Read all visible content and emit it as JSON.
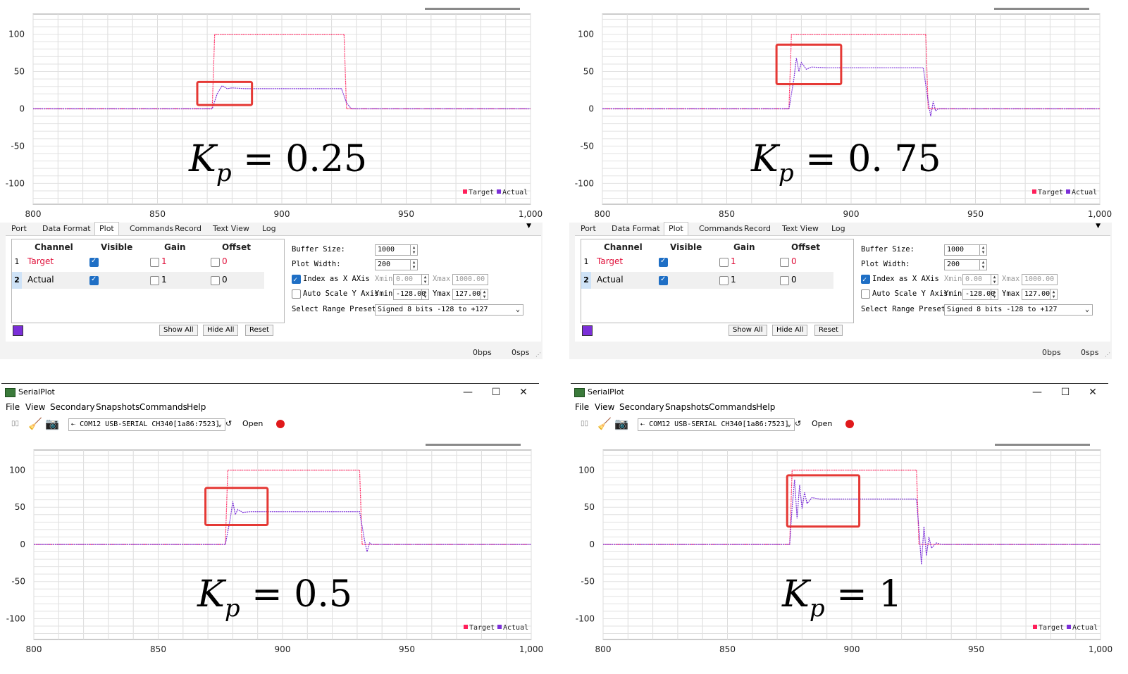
{
  "chart_data": [
    {
      "type": "line",
      "title": "",
      "xlabel": "",
      "ylabel": "",
      "x_ticks": [
        "800",
        "850",
        "900",
        "950",
        "1,000"
      ],
      "y_ticks": [
        "100",
        "50",
        "0",
        "-50",
        "-100"
      ],
      "xlim": [
        800,
        1000
      ],
      "ylim": [
        -128,
        127
      ],
      "grid": true,
      "legend": "bottom-right",
      "series": [
        {
          "name": "Target",
          "color": "#ff1f5a",
          "x": [
            800,
            872,
            873,
            925,
            926,
            1000
          ],
          "y": [
            0,
            0,
            100,
            100,
            0,
            0
          ]
        },
        {
          "name": "Actual",
          "color": "#7b2fd8",
          "x": [
            800,
            872,
            874,
            876,
            878,
            880,
            885,
            900,
            910,
            920,
            924,
            926,
            928,
            1000
          ],
          "y": [
            0,
            0,
            20,
            31,
            27,
            28,
            27,
            27,
            27,
            27,
            27,
            8,
            0,
            0
          ]
        }
      ]
    },
    {
      "type": "line",
      "title": "",
      "xlabel": "",
      "ylabel": "",
      "x_ticks": [
        "800",
        "850",
        "900",
        "950",
        "1,000"
      ],
      "y_ticks": [
        "100",
        "50",
        "0",
        "-50",
        "-100"
      ],
      "xlim": [
        800,
        1000
      ],
      "ylim": [
        -128,
        127
      ],
      "grid": true,
      "legend": "bottom-right",
      "series": [
        {
          "name": "Target",
          "color": "#ff1f5a",
          "x": [
            800,
            875,
            876,
            930,
            931,
            1000
          ],
          "y": [
            0,
            0,
            100,
            100,
            0,
            0
          ]
        },
        {
          "name": "Actual",
          "color": "#7b2fd8",
          "x": [
            800,
            875,
            877,
            878,
            879,
            880,
            882,
            884,
            890,
            900,
            910,
            920,
            929,
            931,
            932,
            933,
            934,
            935,
            1000
          ],
          "y": [
            0,
            0,
            40,
            68,
            50,
            62,
            53,
            56,
            55,
            55,
            55,
            55,
            55,
            10,
            -10,
            10,
            -3,
            0,
            0
          ]
        }
      ]
    },
    {
      "type": "line",
      "title": "",
      "xlabel": "",
      "ylabel": "",
      "x_ticks": [
        "800",
        "850",
        "900",
        "950",
        "1,000"
      ],
      "y_ticks": [
        "100",
        "50",
        "0",
        "-50",
        "-100"
      ],
      "xlim": [
        800,
        1000
      ],
      "ylim": [
        -128,
        127
      ],
      "grid": true,
      "legend": "bottom-right",
      "series": [
        {
          "name": "Target",
          "color": "#ff1f5a",
          "x": [
            800,
            877,
            878,
            931,
            932,
            1000
          ],
          "y": [
            0,
            0,
            100,
            100,
            0,
            0
          ]
        },
        {
          "name": "Actual",
          "color": "#7b2fd8",
          "x": [
            800,
            877,
            879,
            880,
            881,
            882,
            884,
            887,
            895,
            905,
            915,
            925,
            931,
            933,
            934,
            935,
            936,
            1000
          ],
          "y": [
            0,
            0,
            35,
            58,
            40,
            47,
            43,
            44,
            44,
            44,
            44,
            44,
            44,
            5,
            -10,
            2,
            0,
            0
          ]
        }
      ]
    },
    {
      "type": "line",
      "title": "",
      "xlabel": "",
      "ylabel": "",
      "x_ticks": [
        "800",
        "850",
        "900",
        "950",
        "1,000"
      ],
      "y_ticks": [
        "100",
        "50",
        "0",
        "-50",
        "-100"
      ],
      "xlim": [
        800,
        1000
      ],
      "ylim": [
        -128,
        127
      ],
      "grid": true,
      "legend": "bottom-right",
      "series": [
        {
          "name": "Target",
          "color": "#ff1f5a",
          "x": [
            800,
            875,
            876,
            926,
            927,
            1000
          ],
          "y": [
            0,
            0,
            100,
            100,
            0,
            0
          ]
        },
        {
          "name": "Actual",
          "color": "#7b2fd8",
          "x": [
            800,
            875,
            876,
            877,
            878,
            879,
            880,
            881,
            882,
            884,
            887,
            895,
            905,
            915,
            926,
            927,
            928,
            929,
            930,
            931,
            932,
            934,
            936,
            1000
          ],
          "y": [
            0,
            0,
            50,
            87,
            35,
            80,
            48,
            70,
            55,
            63,
            61,
            61,
            61,
            61,
            61,
            20,
            -27,
            24,
            -15,
            10,
            -5,
            2,
            0,
            0
          ]
        }
      ]
    }
  ],
  "kp_labels": [
    {
      "k": "K",
      "p": "p",
      "eq": " = 0.25"
    },
    {
      "k": "K",
      "p": "p",
      "eq": " = 0. 75"
    },
    {
      "k": "K",
      "p": "p",
      "eq": " = 0.5"
    },
    {
      "k": "K",
      "p": "p",
      "eq": " = 1"
    }
  ],
  "legend": {
    "target": "Target",
    "actual": "Actual"
  },
  "tabs": [
    "Port",
    "Data Format",
    "Plot",
    "Commands",
    "Record",
    "Text View",
    "Log"
  ],
  "channel_table": {
    "headers": [
      "Channel",
      "Visible",
      "Gain",
      "Offset"
    ],
    "rows": [
      {
        "num": "1",
        "name": "Target",
        "gain": "1",
        "offset": "0",
        "color": "#e0103a"
      },
      {
        "num": "2",
        "name": "Actual",
        "gain": "1",
        "offset": "0",
        "color": "#222222"
      }
    ]
  },
  "buttons": {
    "show_all": "Show All",
    "hide_all": "Hide All",
    "reset": "Reset"
  },
  "settings": {
    "buffer_label": "Buffer Size:",
    "buffer_value": "1000",
    "plot_width_label": "Plot Width:",
    "plot_width_value": "200",
    "index_x_label": "Index as X AXis",
    "xmin_label": "Xmin",
    "xmin_value": "0.00",
    "xmax_label": "Xmax",
    "xmax_value": "1000.00",
    "auto_scale_label": "Auto Scale Y Axis",
    "ymin_label": "Ymin",
    "ymin_value": "-128.00",
    "ymax_label": "Ymax",
    "ymax_value": "127.00",
    "preset_label": "Select Range Preset:",
    "preset_value": "Signed 8 bits -128 to +127"
  },
  "status": {
    "bps": "0bps",
    "sps": "0sps"
  },
  "window": {
    "title": "SerialPlot",
    "menus": [
      "File",
      "View",
      "Secondary",
      "Snapshots",
      "Commands",
      "Help"
    ],
    "port": "COM12 USB-SERIAL CH340[1a86:7523]",
    "open": "Open",
    "minimize": "—",
    "maximize": "☐",
    "close": "✕"
  }
}
